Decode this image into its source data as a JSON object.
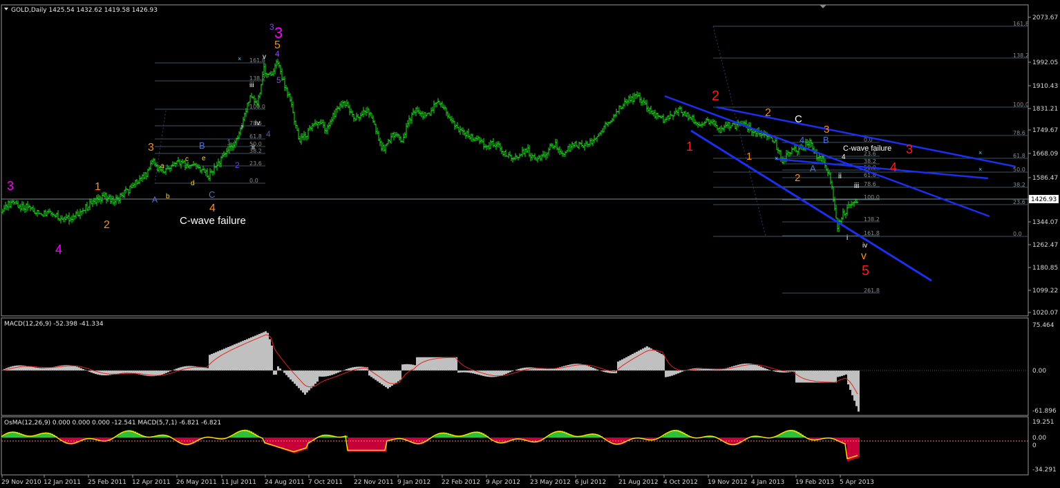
{
  "chart_data": [
    {
      "type": "line",
      "title": "GOLD,Daily",
      "ohlc": {
        "open": "1425.54",
        "high": "1432.62",
        "low": "1419.58",
        "close": "1426.93"
      },
      "y_ticks": [
        "2073.67",
        "1992.05",
        "1910.43",
        "1831.21",
        "1749.67",
        "1668.09",
        "1586.47",
        "1504.85",
        "1426.93",
        "1344.07",
        "1262.47",
        "1180.85",
        "1099.22",
        "1020.07"
      ],
      "ylim": [
        1020,
        2100
      ],
      "current_price": "1426.93",
      "x_ticks": [
        "29 Nov 2010",
        "12 Jan 2011",
        "25 Feb 2011",
        "12 Apr 2011",
        "26 May 2011",
        "11 Jul 2011",
        "24 Aug 2011",
        "7 Oct 2011",
        "22 Nov 2011",
        "9 Jan 2012",
        "22 Feb 2012",
        "9 Apr 2012",
        "23 May 2012",
        "6 Jul 2012",
        "21 Aug 2012",
        "4 Oct 2012",
        "19 Nov 2012",
        "4 Jan 2013",
        "19 Feb 2013",
        "5 Apr 2013"
      ],
      "series": [
        {
          "x": [
            0,
            10,
            20,
            30,
            40,
            50,
            60,
            70,
            80,
            90,
            100,
            110,
            120,
            130,
            140,
            150,
            160,
            170,
            180,
            190,
            200,
            210,
            220,
            230,
            240,
            250,
            260,
            270,
            280,
            290,
            300,
            310,
            320,
            330,
            340,
            350,
            360,
            370,
            380,
            390,
            400,
            410,
            420,
            430,
            440,
            450,
            460,
            470,
            480,
            490,
            500,
            510,
            520,
            530,
            540,
            550,
            560,
            570,
            580,
            590,
            600,
            610,
            620,
            630,
            640,
            650,
            660,
            670,
            680,
            690,
            700,
            710,
            720,
            730,
            740,
            750,
            760,
            770,
            780,
            790,
            800,
            810,
            820,
            830,
            840,
            850,
            860,
            870,
            880,
            890,
            900,
            910,
            920,
            930,
            940,
            950,
            960,
            970,
            980,
            990,
            1000,
            1010,
            1020,
            1030,
            1040,
            1050,
            1060,
            1070,
            1080,
            1090,
            1100,
            1110,
            1120,
            1130,
            1140,
            1150,
            1160,
            1170,
            1180,
            1190,
            1200,
            1210,
            1220,
            1230,
            1240
          ],
          "y": [
            1390,
            1405,
            1410,
            1395,
            1398,
            1380,
            1372,
            1385,
            1368,
            1352,
            1360,
            1375,
            1390,
            1410,
            1425,
            1435,
            1418,
            1430,
            1450,
            1470,
            1495,
            1510,
            1560,
            1520,
            1530,
            1545,
            1555,
            1540,
            1550,
            1525,
            1505,
            1540,
            1570,
            1600,
            1630,
            1700,
            1790,
            1750,
            1880,
            1860,
            1910,
            1820,
            1760,
            1630,
            1650,
            1680,
            1700,
            1660,
            1720,
            1750,
            1760,
            1700,
            1720,
            1745,
            1690,
            1600,
            1620,
            1660,
            1630,
            1700,
            1740,
            1720,
            1730,
            1760,
            1750,
            1700,
            1670,
            1660,
            1640,
            1640,
            1600,
            1620,
            1610,
            1580,
            1560,
            1580,
            1600,
            1570,
            1575,
            1595,
            1620,
            1585,
            1600,
            1620,
            1610,
            1620,
            1640,
            1670,
            1700,
            1730,
            1760,
            1775,
            1785,
            1765,
            1730,
            1715,
            1700,
            1720,
            1740,
            1720,
            1705,
            1690,
            1700,
            1690,
            1660,
            1690,
            1680,
            1690,
            1675,
            1665,
            1650,
            1640,
            1620,
            1560,
            1590,
            1600,
            1610,
            1620,
            1580,
            1560,
            1490,
            1330,
            1380,
            1410,
            1426.93
          ]
        }
      ],
      "fib_levels_left": [
        "161.8",
        "138.2",
        "100.0",
        "78.6",
        "61.8",
        "50.0",
        "38.2",
        "23.6",
        "0.0"
      ],
      "fib_levels_mid": [
        "0.0",
        "23.6",
        "38.2",
        "50.0",
        "61.8",
        "78.6",
        "100.0",
        "138.2",
        "161.8",
        "261.8"
      ],
      "fib_levels_right": [
        "161.8",
        "138.2",
        "100.0",
        "78.6",
        "61.8",
        "50.0",
        "38.2",
        "23.6",
        "0.0"
      ],
      "annotations": [
        "3",
        "4",
        "1",
        "2",
        "3",
        "a",
        "b",
        "A",
        "c",
        "d",
        "e",
        "B",
        "C",
        "4",
        "C-wave failure",
        "1",
        "2",
        "i",
        "ii",
        "iii",
        "iv",
        "v",
        "3",
        "4",
        "5",
        "4",
        "3",
        "5",
        "1",
        "2",
        "2",
        "1",
        "2",
        "3",
        "4",
        "A",
        "B",
        "C",
        "C-wave failure",
        "ii",
        "i",
        "iii",
        "iv",
        "v",
        "5",
        "3",
        "4",
        "4"
      ]
    },
    {
      "type": "bar",
      "title": "MACD(12,26,9) -52.398 -41.334",
      "y_ticks": [
        "75.464",
        "0.00",
        "-61.896"
      ],
      "ylim": [
        -65,
        80
      ]
    },
    {
      "type": "bar",
      "title": "OsMA(12,26,9) 0.000 0.000 0.000 -12.541  MACD(5,7,1) -6.821 -6.821",
      "y_ticks": [
        "19.251",
        "0.00",
        "0",
        "-34.291"
      ],
      "ylim": [
        -36,
        21
      ]
    }
  ]
}
